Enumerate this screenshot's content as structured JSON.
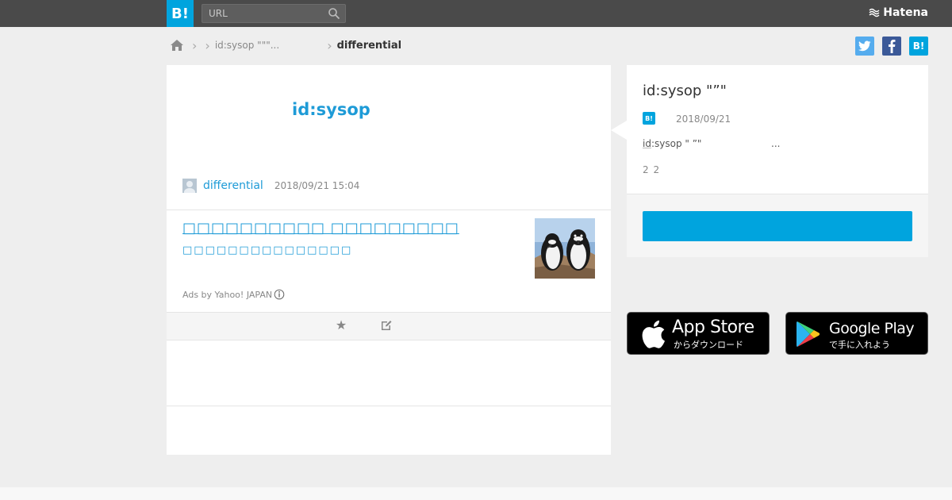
{
  "header": {
    "logo_text": "B!",
    "search_placeholder": "URL",
    "brand": "Hatena"
  },
  "breadcrumb": {
    "parent": "id:sysop \"\"\"...",
    "current": "differential"
  },
  "main": {
    "user_title": "id:sysop",
    "username": "differential",
    "datetime": "2018/09/21 15:04",
    "ad": {
      "title": "□□□□□□□□□□ □□□□□□□□□",
      "description": "□□□□□□□□□□□□□□□",
      "ads_by": "Ads by Yahoo! JAPAN"
    }
  },
  "side": {
    "title": "id:sysop \"”\"",
    "badge": "B!",
    "date": "2018/09/21",
    "desc_prefix": "id",
    "desc_rest": ":sysop \"  ”\"",
    "desc_ellipsis": "...",
    "count": "2 2"
  },
  "stores": {
    "apple_big": "App Store",
    "apple_small": "からダウンロード",
    "google_big": "Google Play",
    "google_small": "で手に入れよう"
  },
  "colors": {
    "accent": "#00a4de",
    "link": "#1e9bd7",
    "topbar": "#4a4a4a",
    "twitter": "#55acee",
    "facebook": "#3b5998"
  }
}
